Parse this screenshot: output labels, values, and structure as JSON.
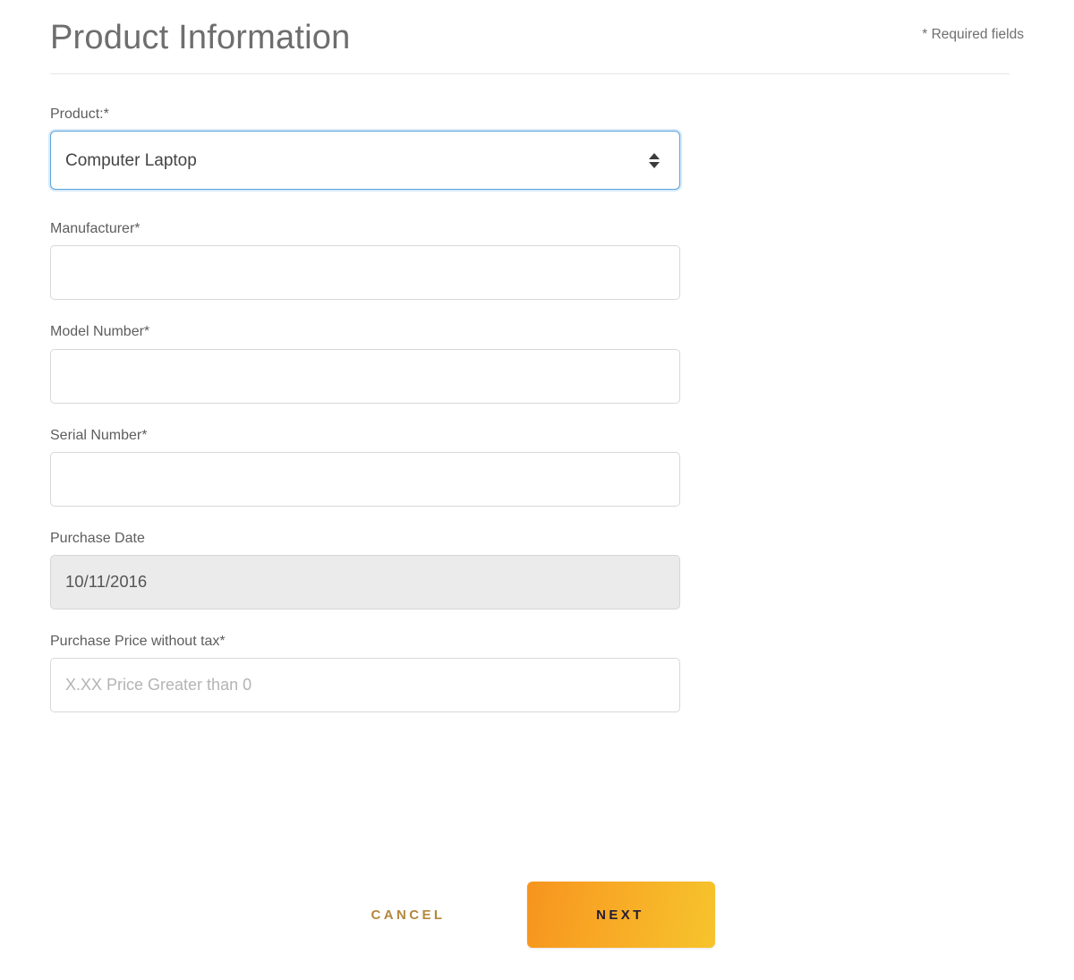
{
  "header": {
    "title": "Product Information",
    "required_note": "* Required fields"
  },
  "form": {
    "fields": [
      {
        "key": "product",
        "label": "Product:*",
        "type": "select",
        "value": "Computer Laptop",
        "stepper_icon": "up-down-arrows-icon",
        "focused": true
      },
      {
        "key": "manufacturer",
        "label": "Manufacturer*",
        "type": "text",
        "value": "",
        "placeholder": ""
      },
      {
        "key": "model_number",
        "label": "Model Number*",
        "type": "text",
        "value": "",
        "placeholder": ""
      },
      {
        "key": "serial_number",
        "label": "Serial Number*",
        "type": "text",
        "value": "",
        "placeholder": ""
      },
      {
        "key": "purchase_date",
        "label": "Purchase Date",
        "type": "text-disabled",
        "value": "10/11/2016",
        "placeholder": ""
      },
      {
        "key": "purchase_price",
        "label": "Purchase Price without tax*",
        "type": "text",
        "value": "",
        "placeholder": "X.XX Price Greater than 0"
      }
    ]
  },
  "actions": {
    "cancel_label": "CANCEL",
    "next_label": "NEXT"
  },
  "colors": {
    "page_background": "#ffffff",
    "title_text": "#6e6e6e",
    "label_text": "#5d5d5d",
    "input_border": "#d8d8d8",
    "focus_border": "#59a6e0",
    "disabled_background": "#ebebeb",
    "cancel_text": "#b5873c",
    "next_gradient_start": "#f6941e",
    "next_gradient_end": "#f6c42c",
    "next_text": "#231c35",
    "divider": "#e6e6e6"
  }
}
